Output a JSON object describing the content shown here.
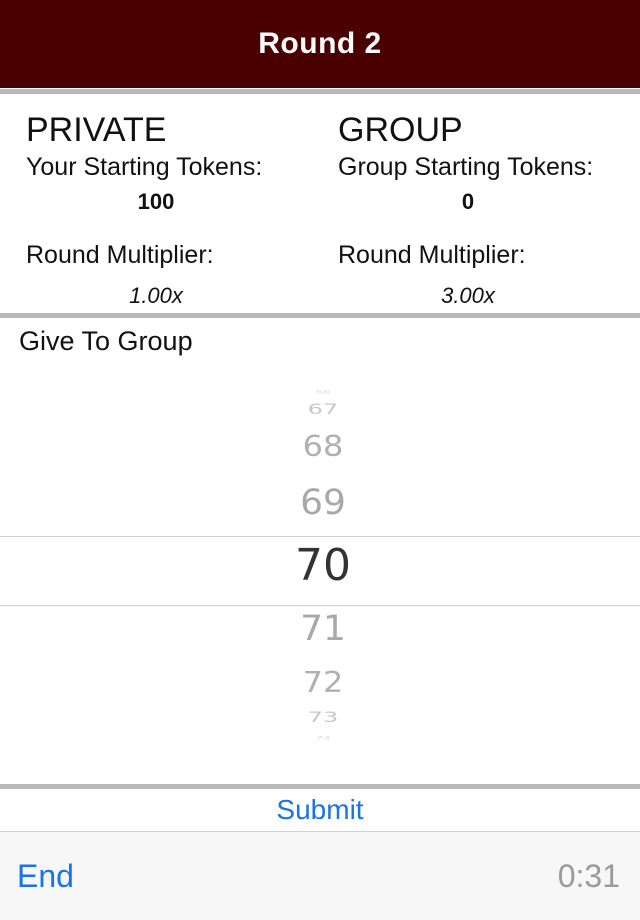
{
  "nav": {
    "title": "Round 2"
  },
  "private": {
    "heading": "PRIVATE",
    "starting_label": "Your Starting Tokens:",
    "starting_value": "100",
    "multiplier_label": "Round Multiplier:",
    "multiplier_value": "1.00x"
  },
  "group": {
    "heading": "GROUP",
    "starting_label": "Group Starting Tokens:",
    "starting_value": "0",
    "multiplier_label": "Round Multiplier:",
    "multiplier_value": "3.00x"
  },
  "give": {
    "title": "Give To Group",
    "picker": {
      "items": [
        "66",
        "67",
        "68",
        "69",
        "70",
        "71",
        "72",
        "73",
        "74"
      ],
      "selected": "70"
    }
  },
  "actions": {
    "submit_label": "Submit"
  },
  "toolbar": {
    "end_label": "End",
    "timer": "0:31"
  },
  "colors": {
    "navbar": "#4a0000",
    "accent": "#1a73e8"
  }
}
